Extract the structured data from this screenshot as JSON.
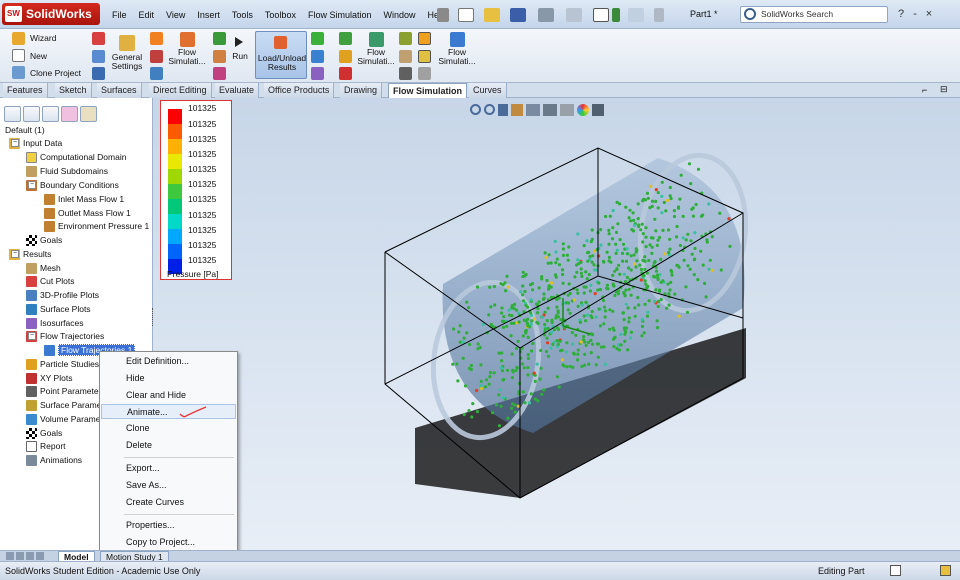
{
  "app": {
    "logo": "SolidWorks",
    "logo_badge": "SW",
    "doc_title": "Part1 *"
  },
  "menu": [
    "File",
    "Edit",
    "View",
    "Insert",
    "Tools",
    "Toolbox",
    "Flow Simulation",
    "Window",
    "Help"
  ],
  "search": {
    "placeholder": "SolidWorks Search"
  },
  "window_buttons": [
    "?",
    "-",
    "×"
  ],
  "ribbon": {
    "wizard": "Wizard",
    "new": "New",
    "clone_project": "Clone Project",
    "general_settings_1": "General",
    "general_settings_2": "Settings",
    "flow_sim1_1": "Flow",
    "flow_sim1_2": "Simulati...",
    "run": "Run",
    "load_unload_1": "Load/Unload",
    "load_unload_2": "Results",
    "flow_sim2_1": "Flow",
    "flow_sim2_2": "Simulati...",
    "flow_sim3_1": "Flow",
    "flow_sim3_2": "Simulati..."
  },
  "cmd_tabs": [
    "Features",
    "Sketch",
    "Surfaces",
    "Direct Editing",
    "Evaluate",
    "Office Products",
    "Drawing",
    "Flow Simulation",
    "Curves"
  ],
  "active_tab": "Flow Simulation",
  "tree": {
    "root": "Default (1)",
    "input_data": "Input Data",
    "computational_domain": "Computational Domain",
    "fluid_subdomains": "Fluid Subdomains",
    "boundary_conditions": "Boundary Conditions",
    "inlet": "Inlet Mass Flow 1",
    "outlet": "Outlet Mass Flow 1",
    "env_pressure": "Environment Pressure 1",
    "goals_in": "Goals",
    "results": "Results",
    "mesh": "Mesh",
    "cut_plots": "Cut Plots",
    "profile_plots": "3D-Profile Plots",
    "surface_plots": "Surface Plots",
    "isosurfaces": "Isosurfaces",
    "flow_trajectories": "Flow Trajectories",
    "flow_trajectory_1": "Flow Trajectories 1",
    "particle_studies": "Particle Studies",
    "xy_plots": "XY Plots",
    "point_params": "Point Parameters",
    "surface_params": "Surface Parameters",
    "volume_params": "Volume Parameters",
    "goals_res": "Goals",
    "report": "Report",
    "animations": "Animations"
  },
  "context_menu": {
    "edit_definition": "Edit Definition...",
    "hide": "Hide",
    "clear_hide": "Clear and Hide",
    "animate": "Animate...",
    "clone": "Clone",
    "delete": "Delete",
    "export": "Export...",
    "save_as": "Save As...",
    "create_curves": "Create Curves",
    "properties": "Properties...",
    "copy_to_project": "Copy to Project..."
  },
  "legend": {
    "values": [
      "101325",
      "101325",
      "101325",
      "101325",
      "101325",
      "101325",
      "101325",
      "101325",
      "101325",
      "101325",
      "101325",
      "101325"
    ],
    "colors": [
      "#ff0000",
      "#ff5a00",
      "#ffb000",
      "#e8e800",
      "#9ed800",
      "#3ec83e",
      "#00c878",
      "#00d8c8",
      "#00a8ff",
      "#0064ff",
      "#0020e8",
      "#0000b0"
    ],
    "title": "Pressure [Pa]"
  },
  "bottom_tabs": [
    "Model",
    "Motion Study 1"
  ],
  "status": {
    "left": "SolidWorks Student Edition - Academic Use Only",
    "right": "Editing Part"
  }
}
